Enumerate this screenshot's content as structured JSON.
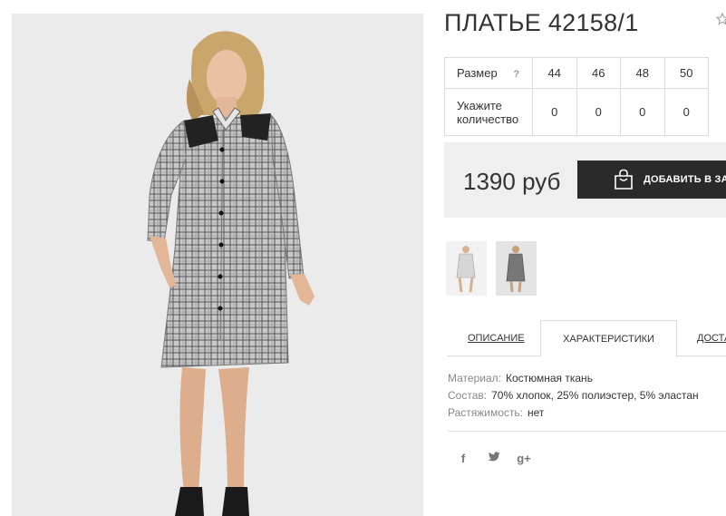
{
  "product": {
    "title": "ПЛАТЬЕ 42158/1"
  },
  "size_table": {
    "size_label": "Размер",
    "help_icon": "?",
    "sizes": [
      "44",
      "46",
      "48",
      "50"
    ],
    "quantity_label_line1": "Укажите",
    "quantity_label_line2": "количество",
    "quantities": [
      "0",
      "0",
      "0",
      "0"
    ]
  },
  "purchase": {
    "price": "1390 руб",
    "add_to_cart_label": "ДОБАВИТЬ В ЗА",
    "button_icon": "shopping-bag-icon"
  },
  "tabs": {
    "description": "ОПИСАНИЕ",
    "characteristics": "ХАРАКТЕРИСТИКИ",
    "delivery": "ДОСТА"
  },
  "properties": [
    {
      "name": "Материал:",
      "value": "Костюмная ткань"
    },
    {
      "name": "Состав:",
      "value": "70% хлопок, 25% полиэстер, 5% эластан"
    },
    {
      "name": "Растяжимость:",
      "value": "нет"
    }
  ],
  "social": {
    "facebook": "f",
    "twitter": "twitter-icon",
    "google_plus": "g+"
  },
  "colors": {
    "button_bg": "#2a2a2a",
    "price_box_bg": "#efefef",
    "border": "#dcdcdc",
    "photo_bg": "#ebebeb"
  }
}
